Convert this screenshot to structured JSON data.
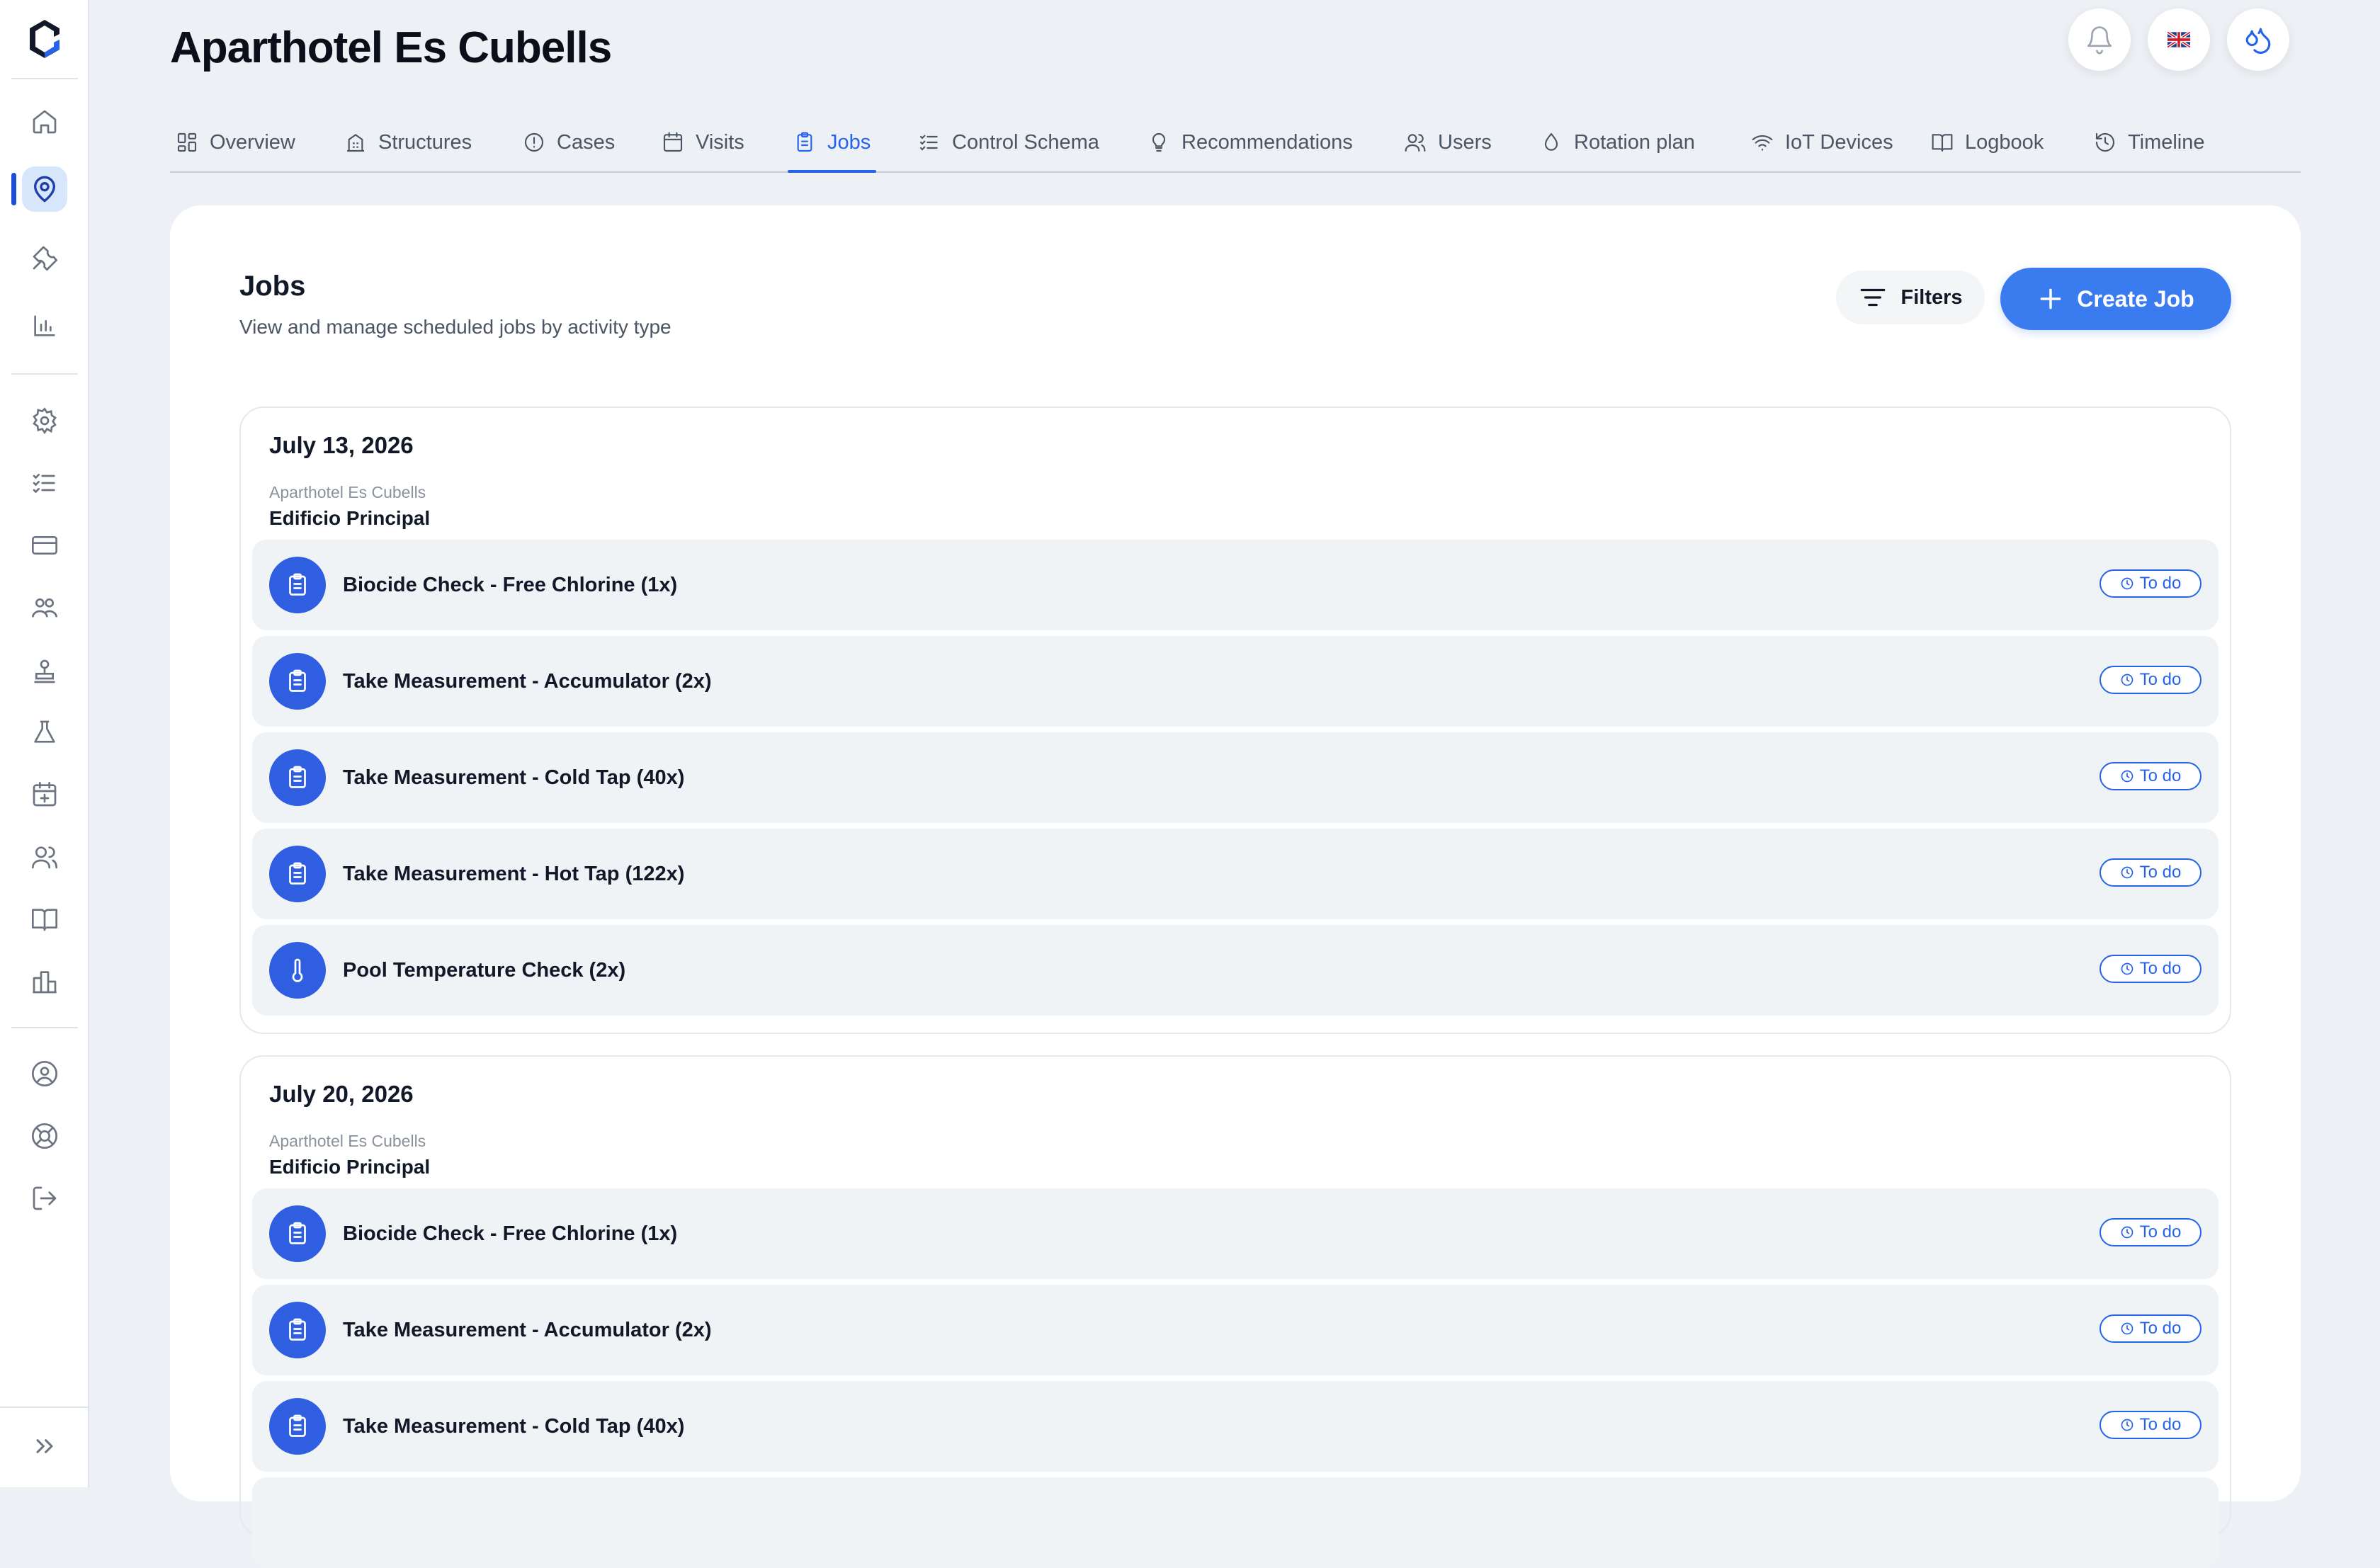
{
  "page": {
    "title": "Aparthotel Es Cubells"
  },
  "header_buttons": [
    {
      "name": "notifications-button",
      "icon": "bell-icon"
    },
    {
      "name": "language-button",
      "icon": "uk-flag-icon"
    },
    {
      "name": "water-button",
      "icon": "droplets-icon"
    }
  ],
  "tabs": [
    {
      "label": "Overview",
      "icon": "grid-icon"
    },
    {
      "label": "Structures",
      "icon": "building-icon"
    },
    {
      "label": "Cases",
      "icon": "alert-circle-icon"
    },
    {
      "label": "Visits",
      "icon": "calendar-icon"
    },
    {
      "label": "Jobs",
      "icon": "clipboard-icon",
      "active": true
    },
    {
      "label": "Control Schema",
      "icon": "list-check-icon"
    },
    {
      "label": "Recommendations",
      "icon": "lightbulb-icon"
    },
    {
      "label": "Users",
      "icon": "users-icon"
    },
    {
      "label": "Rotation plan",
      "icon": "droplet-icon"
    },
    {
      "label": "IoT Devices",
      "icon": "wifi-icon"
    },
    {
      "label": "Logbook",
      "icon": "book-icon"
    },
    {
      "label": "Timeline",
      "icon": "history-icon"
    }
  ],
  "jobs_panel": {
    "title": "Jobs",
    "subtitle": "View and manage scheduled jobs by activity type",
    "filters_label": "Filters",
    "create_label": "Create Job"
  },
  "groups": [
    {
      "date": "July 13, 2026",
      "site": "Aparthotel Es Cubells",
      "building": "Edificio Principal",
      "jobs": [
        {
          "label": "Biocide Check - Free Chlorine (1x)",
          "status": "To do",
          "icon": "clipboard-icon"
        },
        {
          "label": "Take Measurement - Accumulator (2x)",
          "status": "To do",
          "icon": "clipboard-icon"
        },
        {
          "label": "Take Measurement - Cold Tap (40x)",
          "status": "To do",
          "icon": "clipboard-icon"
        },
        {
          "label": "Take Measurement - Hot Tap (122x)",
          "status": "To do",
          "icon": "clipboard-icon"
        },
        {
          "label": "Pool Temperature Check (2x)",
          "status": "To do",
          "icon": "thermometer-icon"
        }
      ]
    },
    {
      "date": "July 20, 2026",
      "site": "Aparthotel Es Cubells",
      "building": "Edificio Principal",
      "jobs": [
        {
          "label": "Biocide Check - Free Chlorine (1x)",
          "status": "To do",
          "icon": "clipboard-icon"
        },
        {
          "label": "Take Measurement - Accumulator (2x)",
          "status": "To do",
          "icon": "clipboard-icon"
        },
        {
          "label": "Take Measurement - Cold Tap (40x)",
          "status": "To do",
          "icon": "clipboard-icon"
        }
      ]
    }
  ],
  "colors": {
    "accent": "#2563eb",
    "primary_button": "#3a7cf0",
    "job_icon": "#2f5fe0",
    "background": "#edf1f5"
  }
}
